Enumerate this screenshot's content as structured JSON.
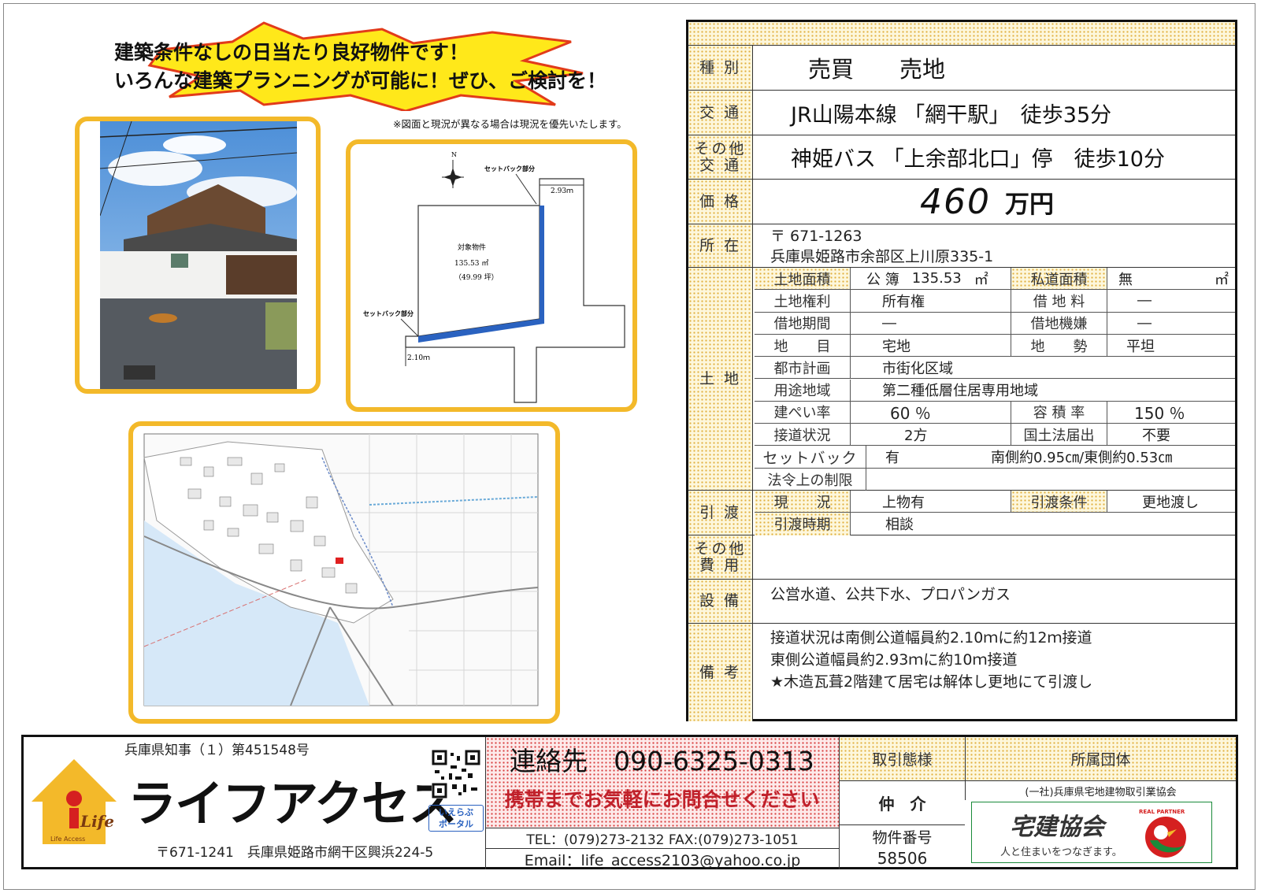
{
  "headline": {
    "line1": "建築条件なしの日当たり良好物件です！",
    "line2": "いろんな建築プランニングが可能に！ぜひ、ご検討を！"
  },
  "note": "※図面と現況が異なる場合は現況を優先いたします。",
  "plan": {
    "setback_label_1": "セットバック部分",
    "setback_label_2": "セットバック部分",
    "dim_east": "2.93ｍ",
    "dim_south": "2.10ｍ",
    "subject_label": "対象物件",
    "area_sqm": "135.53 ㎡",
    "area_tsubo": "（49.99 坪）"
  },
  "spec": {
    "kind": {
      "label": "種 別",
      "value": "売買　　売地"
    },
    "access": {
      "label": "交 通",
      "value": "JR山陽本線 「網干駅」　徒歩35分"
    },
    "access_other": {
      "label": "その他\n交 通",
      "value": "神姫バス 「上余部北口」停　徒歩10分"
    },
    "price": {
      "label": "価 格",
      "number": "460",
      "unit": "万円"
    },
    "address": {
      "label": "所 在",
      "zip": "〒 671-1263",
      "line": "兵庫県姫路市余部区上川原335-1"
    },
    "land": {
      "label": "土 地",
      "area_label": "土地面積",
      "area_type": "公 簿",
      "area_value": "135.53",
      "area_unit": "㎡",
      "private_road_label": "私道面積",
      "private_road_value": "無",
      "private_road_unit": "㎡",
      "right_label": "土地権利",
      "right_value": "所有権",
      "rent_label": "借 地 料",
      "rent_value": "―",
      "lease_label": "借地期間",
      "lease_value": "―",
      "lease_end_label": "借地機嫌",
      "lease_end_value": "―",
      "category_label": "地　　目",
      "category_value": "宅地",
      "terrain_label": "地　　勢",
      "terrain_value": "平坦",
      "city_plan_label": "都市計画",
      "city_plan_value": "市街化区域",
      "zoning_label": "用途地域",
      "zoning_value": "第二種低層住居専用地域",
      "bcr_label": "建ぺい率",
      "bcr_value": "60 ％",
      "far_label": "容 積 率",
      "far_value": "150 ％",
      "road_label": "接道状況",
      "road_value": "2方",
      "notify_label": "国土法届出",
      "notify_value": "不要",
      "setback_label": "セットバック",
      "setback_value": "有",
      "setback_detail": "南側約0.95㎝/東側約0.53㎝",
      "legal_label": "法令上の制限",
      "legal_value": ""
    },
    "handover": {
      "label": "引 渡",
      "status_label": "現　　況",
      "status_value": "上物有",
      "cond_label": "引渡条件",
      "cond_value": "更地渡し",
      "time_label": "引渡時期",
      "time_value": "相談"
    },
    "other_cost": {
      "label": "その他\n費 用",
      "value": ""
    },
    "facilities": {
      "label": "設 備",
      "value": "公営水道、公共下水、プロパンガス"
    },
    "remarks": {
      "label": "備 考",
      "line1": "接道状況は南側公道幅員約2.10ｍに約12ｍ接道",
      "line2": "東側公道幅員約2.93ｍに約10ｍ接道",
      "line3": "★木造瓦葺2階建て居宅は解体し更地にて引渡し"
    }
  },
  "footer": {
    "license": "兵庫県知事（１）第451548号",
    "company": "ライフアクセス",
    "logo_text": "Life",
    "logo_sub": "Life Access",
    "address": "〒671-1241　兵庫県姫路市網干区興浜224-5",
    "portal": "いえらぶ\nポータル",
    "contact": "連絡先　090-6325-0313",
    "contact_sub": "携帯までお気軽にお問合せください",
    "tel_fax": "TEL：(079)273-2132 FAX:(079)273-1051",
    "email": "Email：life_access2103@yahoo.co.jp",
    "deal_label": "取引態様",
    "deal_value": "仲　介",
    "property_no_label": "物件番号",
    "property_no": "58506",
    "org_label": "所属団体",
    "org_name": "(一社)兵庫県宅地建物取引業協会",
    "org_logo": "宅建協会",
    "org_tagline": "人と住まいをつなぎます。",
    "org_badge": "REAL PARTNER"
  },
  "colors": {
    "accent": "#f3b92a",
    "setback": "#2a62c0",
    "red": "#c0202a",
    "green": "#1a8a3a"
  }
}
